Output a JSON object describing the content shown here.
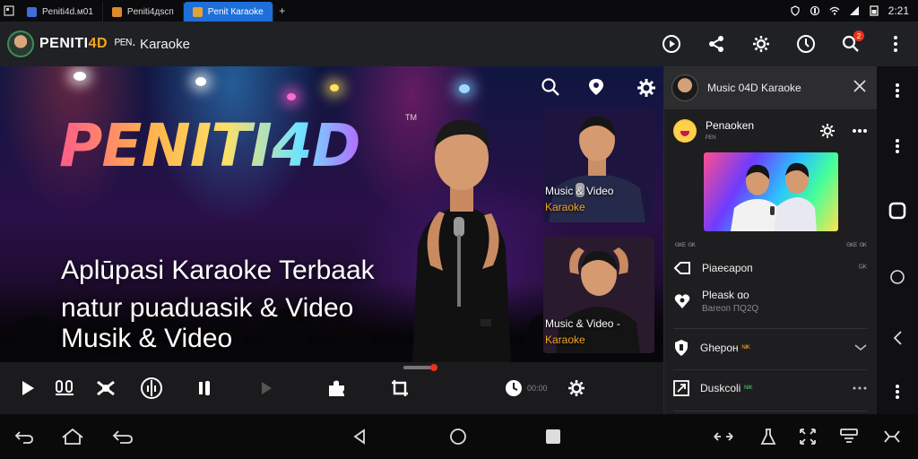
{
  "tabs": [
    {
      "label": "Pеnitі4d.м01",
      "active": false,
      "color": "#3c6fd9"
    },
    {
      "label": "Pеnіtі4дѕсп",
      "active": false,
      "color": "#e0892d"
    },
    {
      "label": "Pеnіt Кaraoke",
      "active": true,
      "color": "#e0a23a"
    }
  ],
  "tab_new_label": "+",
  "statusbar": {
    "time": "2:21"
  },
  "header": {
    "logo_main": "PENITI",
    "logo_accent": "4D",
    "title": "ᴾᴱᴺ· Kаraoke",
    "notification_count": "2",
    "icons": [
      "play-circle-icon",
      "share-icon",
      "settings-icon",
      "timer-icon",
      "search-notify-icon",
      "more-vert-icon"
    ]
  },
  "hero": {
    "brand": "PENITI4D",
    "brand_tm": "TM",
    "tagline_lines": [
      "Aplūpasi Karaoke  Terbaak",
      "natur puaduasik & Video",
      "Musik & Video"
    ],
    "thumb1_caption": "Music & Video",
    "thumb1_sub": "Karaoke",
    "thumb2_caption": "Music & Video -",
    "thumb2_sub": "Karaoke"
  },
  "player": {
    "progress": 0.85,
    "time": "00:00",
    "icons": [
      "play-icon",
      "mic-icon",
      "shuffle-icon",
      "equalizer-icon",
      "pause-icon",
      "next-icon",
      "puzzle-icon",
      "crop-icon",
      "clock-icon",
      "gear-icon"
    ]
  },
  "panel": {
    "title": "Music 04D Karaoke",
    "channel_name": "Penaoken",
    "channel_sub": "ᴾᴱᴺ",
    "meta_left": "ᴳᴷᴱ ᴳᴷ",
    "meta_right": "ᴳᴷᴱ ᴳᴷ",
    "items": [
      {
        "label": "Ріаеєароп",
        "value": "ᴳᴷ",
        "sub": "",
        "tag": "",
        "tag_color": ""
      },
      {
        "label": "Рlеаsk ɑо",
        "value": "",
        "sub": "Вareоп ПQ2Q",
        "tag": "",
        "tag_color": ""
      },
      {
        "label": "Gheрон",
        "value": "",
        "sub": "",
        "tag": "ᴺᴵᴷ",
        "tag_color": "orange"
      },
      {
        "label": "Duskcoli",
        "value": "",
        "sub": "",
        "tag": "ᴺᴵᴷ",
        "tag_color": "green"
      }
    ]
  },
  "colors": {
    "accent": "#f5a524",
    "notify": "#e8321a",
    "active_tab": "#1e6fd9"
  }
}
